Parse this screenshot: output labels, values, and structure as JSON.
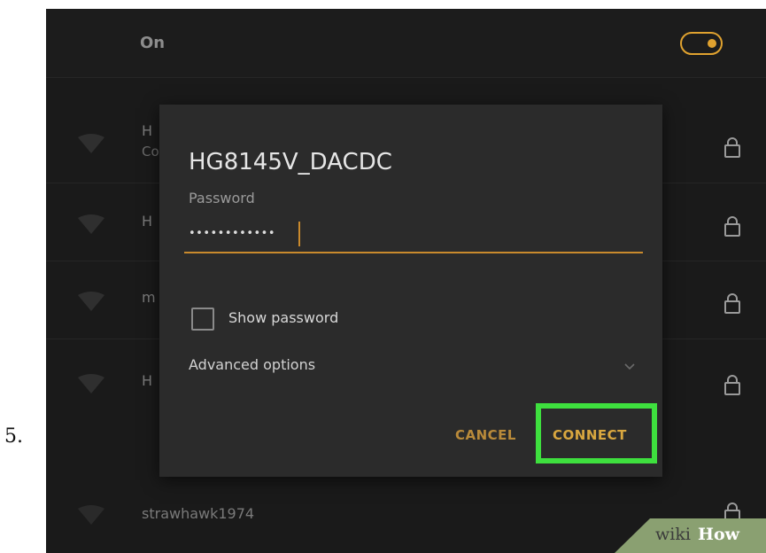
{
  "step": {
    "number": "5."
  },
  "wifi": {
    "toggle_label": "On",
    "toggle_state": "on"
  },
  "networks": [
    {
      "name_partial": "H",
      "sub_partial": "Co",
      "secured": true
    },
    {
      "name_partial": "H",
      "secured": true
    },
    {
      "name_partial": "m",
      "secured": true
    },
    {
      "name_partial": "H",
      "secured": true
    },
    {
      "name": "strawhawk1974",
      "secured": true
    }
  ],
  "dialog": {
    "title": "HG8145V_DACDC",
    "password_label": "Password",
    "password_value": "••••••••••••",
    "show_password_label": "Show password",
    "show_password_checked": false,
    "advanced_label": "Advanced options",
    "cancel_label": "CANCEL",
    "connect_label": "CONNECT"
  },
  "watermark": {
    "wiki": "wiki",
    "how": "How"
  },
  "colors": {
    "accent": "#e0a22f",
    "highlight_box": "#3ee03e",
    "dialog_bg": "#2b2b2b",
    "screen_bg": "#1a1a1a"
  },
  "icons": {
    "wifi": "wifi-icon",
    "lock": "lock-icon",
    "chevron": "chevron-down-icon"
  }
}
